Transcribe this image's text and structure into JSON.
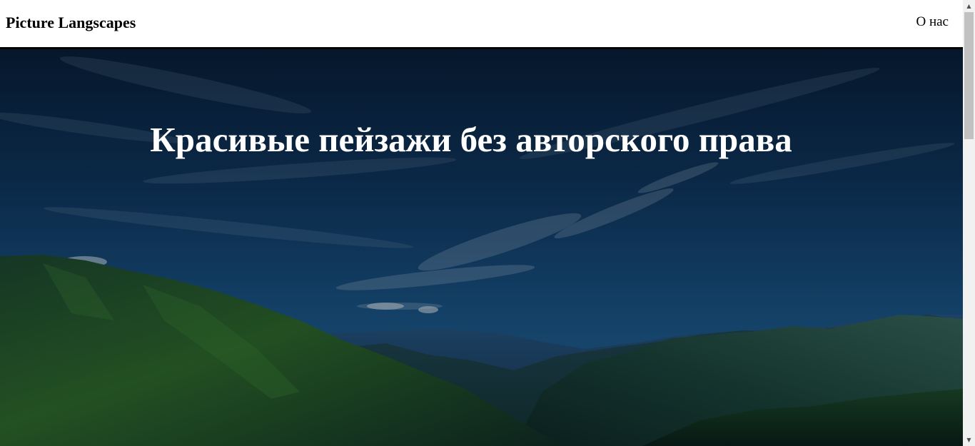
{
  "navbar": {
    "brand": "Picture Langscapes",
    "links": [
      {
        "label": "О нас"
      }
    ]
  },
  "hero": {
    "title": "Красивые пейзажи без авторского права"
  },
  "colors": {
    "nav_background": "#ffffff",
    "nav_border": "#000000",
    "sky_top": "#0b2440",
    "sky_mid": "#14416a",
    "mountain_dark": "#0f2a24",
    "mountain_green": "#2d6b2a",
    "title_text": "#ffffff"
  }
}
